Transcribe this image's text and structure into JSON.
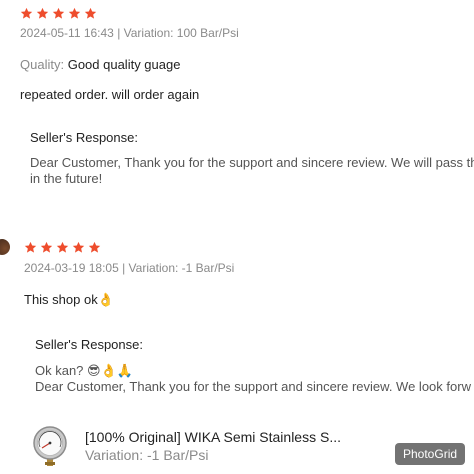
{
  "colors": {
    "star": "#ee4d2d",
    "meta": "#8a8a8a",
    "text": "#222222",
    "response_text": "#555555"
  },
  "reviews": [
    {
      "rating": 5,
      "meta": "2024-05-11 16:43 | Variation: 100 Bar/Psi",
      "quality_label": "Quality:",
      "quality_value": "Good quality guage",
      "text": "repeated order. will order again",
      "seller_response_title": "Seller's Response:",
      "seller_response_lines": [
        "Dear Customer, Thank you for the support and sincere review. We will pass thi",
        "in the future!"
      ]
    },
    {
      "rating": 5,
      "meta": "2024-03-19 18:05 | Variation: -1 Bar/Psi",
      "text": "This shop ok",
      "text_emoji": "👌",
      "seller_response_title": "Seller's Response:",
      "seller_response_lines": [
        "Ok kan? 😎👌🙏",
        "Dear Customer, Thank you for the support and sincere review. We look forw"
      ]
    }
  ],
  "product": {
    "icon": "pressure-gauge-icon",
    "title": "[100% Original] WIKA Semi Stainless S...",
    "variation": "Variation: -1 Bar/Psi"
  },
  "watermark": "PhotoGrid"
}
